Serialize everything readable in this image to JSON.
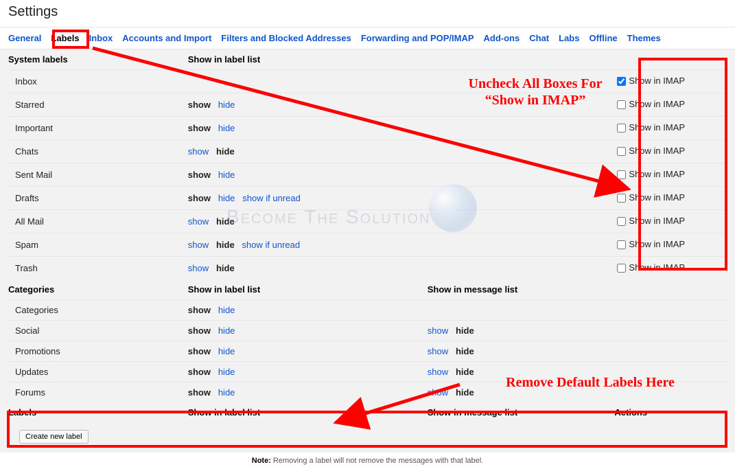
{
  "page_title": "Settings",
  "tabs": [
    {
      "label": "General",
      "active": false
    },
    {
      "label": "Labels",
      "active": true
    },
    {
      "label": "Inbox",
      "active": false
    },
    {
      "label": "Accounts and Import",
      "active": false
    },
    {
      "label": "Filters and Blocked Addresses",
      "active": false
    },
    {
      "label": "Forwarding and POP/IMAP",
      "active": false
    },
    {
      "label": "Add-ons",
      "active": false
    },
    {
      "label": "Chat",
      "active": false
    },
    {
      "label": "Labs",
      "active": false
    },
    {
      "label": "Offline",
      "active": false
    },
    {
      "label": "Themes",
      "active": false
    }
  ],
  "headers": {
    "system_labels": "System labels",
    "categories": "Categories",
    "labels": "Labels",
    "show_in_label_list": "Show in label list",
    "show_in_message_list": "Show in message list",
    "actions": "Actions"
  },
  "text": {
    "show": "show",
    "hide": "hide",
    "show_if_unread": "show if unread",
    "show_in_imap": "Show in IMAP",
    "create_new_label": "Create new label",
    "note_bold": "Note:",
    "note_rest": " Removing a label will not remove the messages with that label."
  },
  "system_rows": [
    {
      "name": "Inbox",
      "show_bold": null,
      "hide_bold": null,
      "extra": null,
      "imap_checked": true
    },
    {
      "name": "Starred",
      "show_bold": "show",
      "hide_bold": null,
      "extra": null,
      "imap_checked": false
    },
    {
      "name": "Important",
      "show_bold": "show",
      "hide_bold": null,
      "extra": null,
      "imap_checked": false
    },
    {
      "name": "Chats",
      "show_bold": null,
      "hide_bold": "hide",
      "extra": null,
      "imap_checked": false
    },
    {
      "name": "Sent Mail",
      "show_bold": "show",
      "hide_bold": null,
      "extra": null,
      "imap_checked": false
    },
    {
      "name": "Drafts",
      "show_bold": "show",
      "hide_bold": null,
      "extra": "show if unread",
      "imap_checked": false
    },
    {
      "name": "All Mail",
      "show_bold": null,
      "hide_bold": "hide",
      "extra": null,
      "imap_checked": false
    },
    {
      "name": "Spam",
      "show_bold": null,
      "hide_bold": "hide",
      "extra": "show if unread",
      "imap_checked": false
    },
    {
      "name": "Trash",
      "show_bold": null,
      "hide_bold": "hide",
      "extra": null,
      "imap_checked": false
    }
  ],
  "category_rows": [
    {
      "name": "Categories",
      "label_show_bold": "show",
      "label_hide_bold": null,
      "msg_show_bold": null,
      "msg_hide_bold": null
    },
    {
      "name": "Social",
      "label_show_bold": "show",
      "label_hide_bold": null,
      "msg_show_bold": null,
      "msg_hide_bold": "hide"
    },
    {
      "name": "Promotions",
      "label_show_bold": "show",
      "label_hide_bold": null,
      "msg_show_bold": null,
      "msg_hide_bold": "hide"
    },
    {
      "name": "Updates",
      "label_show_bold": "show",
      "label_hide_bold": null,
      "msg_show_bold": null,
      "msg_hide_bold": "hide"
    },
    {
      "name": "Forums",
      "label_show_bold": "show",
      "label_hide_bold": null,
      "msg_show_bold": null,
      "msg_hide_bold": "hide"
    }
  ],
  "annotations": {
    "uncheck_line1": "Uncheck All Boxes For",
    "uncheck_line2": "“Show in IMAP”",
    "remove_labels": "Remove Default Labels Here"
  },
  "watermark": "Become The Solution"
}
